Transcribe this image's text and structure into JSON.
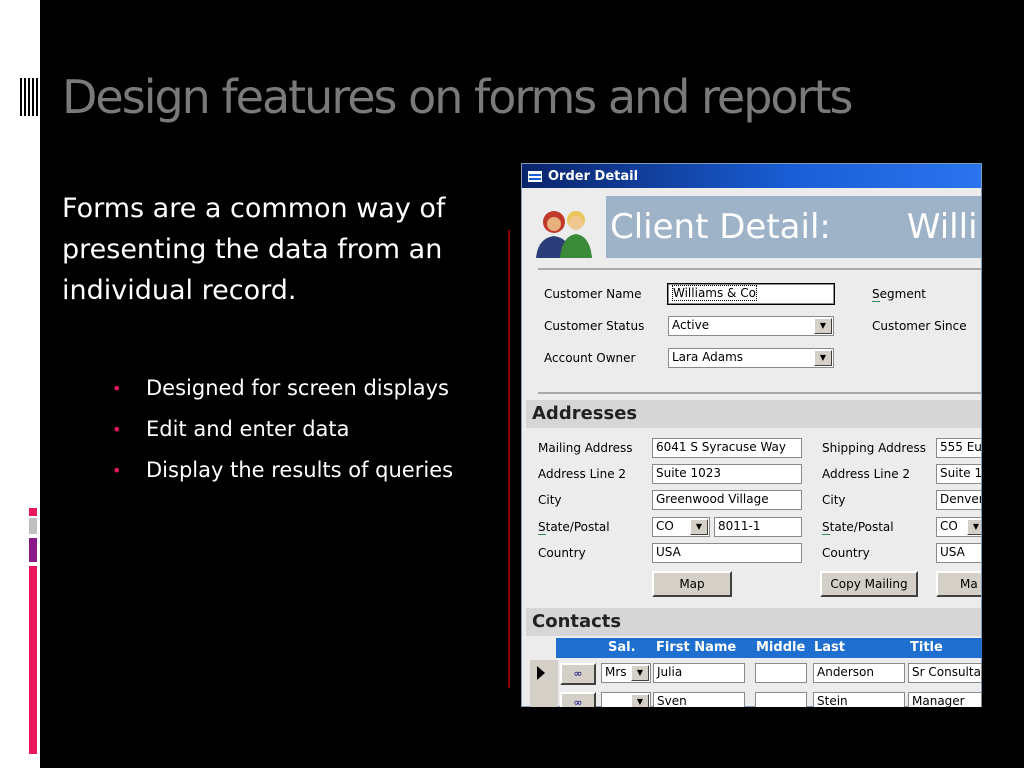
{
  "slide": {
    "title": "Design features on forms and reports",
    "intro": "Forms are a common way of presenting the data from an individual record.",
    "bullets": [
      "Designed for screen displays",
      "Edit and enter data",
      "Display the results of queries"
    ],
    "bullet_symbol": "•",
    "colors": {
      "background": "#000000",
      "title": "#7a7a7a",
      "bullet": "#e8175d",
      "accent_pink": "#e8175d",
      "accent_purple": "#8b1a8b",
      "accent_gray": "#c0c0c0"
    }
  },
  "window": {
    "title": "Order Detail",
    "title_icon": "form-icon",
    "header": {
      "text": "Client Detail:",
      "name_fragment": "Willi",
      "icon": "people-icon"
    },
    "client": {
      "customer_name_label": "Customer Name",
      "customer_name_value": "Williams & Co",
      "customer_status_label": "Customer Status",
      "customer_status_value": "Active",
      "account_owner_label": "Account Owner",
      "account_owner_value": "Lara Adams",
      "segment_label_first": "S",
      "segment_label_rest": "egment",
      "customer_since_label": "Customer Since"
    },
    "addresses": {
      "section_title": "Addresses",
      "mailing": {
        "address_label": "Mailing Address",
        "address_value": "6041 S Syracuse Way",
        "line2_label": "Address Line 2",
        "line2_value": "Suite 1023",
        "city_label": "City",
        "city_value": "Greenwood Village",
        "state_label_first": "S",
        "state_label_rest": "tate/Postal",
        "state_value": "CO",
        "postal_value": "8011-1",
        "country_label": "Country",
        "country_value": "USA",
        "map_button": "Map"
      },
      "shipping": {
        "address_label": "Shipping Address",
        "address_value": "555 Eu",
        "line2_label": "Address Line 2",
        "line2_value": "Suite 1",
        "city_label": "City",
        "city_value": "Denver",
        "state_label_first": "S",
        "state_label_rest": "tate/Postal",
        "state_value": "CO",
        "country_label": "Country",
        "country_value": "USA",
        "copy_button": "Copy Mailing",
        "map_button": "Ma"
      }
    },
    "contacts": {
      "section_title": "Contacts",
      "columns": [
        "Sal.",
        "First Name",
        "Middle",
        "Last",
        "Title"
      ],
      "rows": [
        {
          "sal": "Mrs",
          "first": "Julia",
          "middle": "",
          "last": "Anderson",
          "title": "Sr Consulta",
          "current": true
        },
        {
          "sal": "",
          "first": "Sven",
          "middle": "",
          "last": "Stein",
          "title": "Manager",
          "current": false
        }
      ]
    }
  }
}
